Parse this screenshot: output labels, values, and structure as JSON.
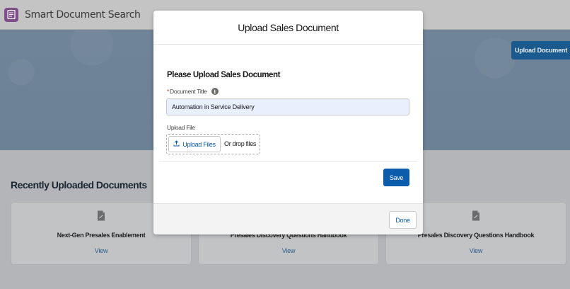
{
  "app": {
    "title": "Smart Document Search",
    "icon": "document-app-icon",
    "icon_color": "#7f4f8a"
  },
  "hero": {
    "upload_button_label": "Upload Document",
    "accent_color": "#1b5a8f"
  },
  "recent": {
    "title": "Recently Uploaded Documents",
    "cards": [
      {
        "name": "Next-Gen Presales Enablement",
        "action": "View",
        "icon": "file-icon"
      },
      {
        "name": "Presales Discovery Questions Handbook",
        "action": "View",
        "icon": "file-icon"
      },
      {
        "name": "Presales Discovery Questions Handbook",
        "action": "View",
        "icon": "file-icon"
      }
    ]
  },
  "modal": {
    "title": "Upload Sales Document",
    "heading": "Please Upload Sales Document",
    "document_title": {
      "required_marker": "*",
      "label": "Document Title",
      "info_icon": "info-icon",
      "value": "Automation in Service Delivery"
    },
    "upload": {
      "label": "Upload File",
      "button_label": "Upload Files",
      "button_icon": "upload-icon",
      "drop_text": "Or drop files"
    },
    "save_label": "Save",
    "done_label": "Done",
    "brand_color": "#0b5cab"
  }
}
